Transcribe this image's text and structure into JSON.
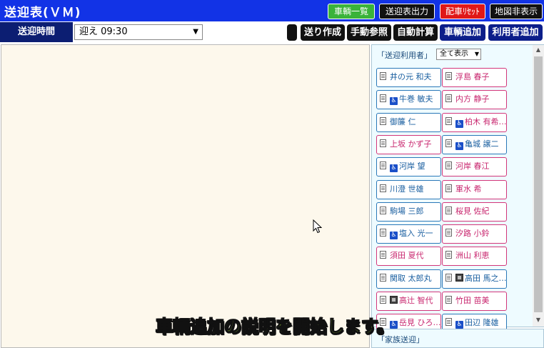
{
  "app": {
    "title": "送迎表(ＶＭ)"
  },
  "header_buttons": [
    {
      "label": "車輌一覧",
      "color": "#3ab33a"
    },
    {
      "label": "送迎表出力",
      "color": "#111111"
    },
    {
      "label": "配車ﾘｾｯﾄ",
      "color": "#e01818"
    },
    {
      "label": "地図非表示",
      "color": "#111111"
    }
  ],
  "toolbar": {
    "time_label": "送迎時間",
    "time_value": "迎え 09:30",
    "blank_button": "",
    "buttons": [
      {
        "label": "送り作成",
        "color": "#111111"
      },
      {
        "label": "手動参照",
        "color": "#111111"
      },
      {
        "label": "自動計算",
        "color": "#111111"
      },
      {
        "label": "車輌追加",
        "color": "#0c1e8a"
      },
      {
        "label": "利用者追加",
        "color": "#0c1e8a"
      }
    ]
  },
  "users_panel": {
    "title": "「送迎利用者」",
    "filter_value": "全て表示",
    "users": [
      {
        "name": "井の元 和夫",
        "gender": "male",
        "wheelchair": false,
        "photo": false
      },
      {
        "name": "浮島 春子",
        "gender": "female",
        "wheelchair": false,
        "photo": false
      },
      {
        "name": "牛巻 敏夫",
        "gender": "male",
        "wheelchair": true,
        "photo": false
      },
      {
        "name": "内方 静子",
        "gender": "female",
        "wheelchair": false,
        "photo": false
      },
      {
        "name": "御簾 仁",
        "gender": "male",
        "wheelchair": false,
        "photo": false
      },
      {
        "name": "柏木 有希…",
        "gender": "female",
        "wheelchair": true,
        "photo": false
      },
      {
        "name": "上坂 かず子",
        "gender": "female",
        "wheelchair": false,
        "photo": false
      },
      {
        "name": "亀城 譲二",
        "gender": "male",
        "wheelchair": true,
        "photo": false
      },
      {
        "name": "河岸 望",
        "gender": "male",
        "wheelchair": true,
        "photo": false
      },
      {
        "name": "河岸 春江",
        "gender": "female",
        "wheelchair": false,
        "photo": false
      },
      {
        "name": "川澄 世雄",
        "gender": "male",
        "wheelchair": false,
        "photo": false
      },
      {
        "name": "軍水 希",
        "gender": "female",
        "wheelchair": false,
        "photo": false
      },
      {
        "name": "駒場 三郎",
        "gender": "male",
        "wheelchair": false,
        "photo": false
      },
      {
        "name": "桜見 佐紀",
        "gender": "female",
        "wheelchair": false,
        "photo": false
      },
      {
        "name": "塩入 光一",
        "gender": "male",
        "wheelchair": true,
        "photo": false
      },
      {
        "name": "汐路 小鈴",
        "gender": "female",
        "wheelchair": false,
        "photo": false
      },
      {
        "name": "須田 夏代",
        "gender": "female",
        "wheelchair": false,
        "photo": false
      },
      {
        "name": "洲山 利恵",
        "gender": "female",
        "wheelchair": false,
        "photo": false
      },
      {
        "name": "関取 太郎丸",
        "gender": "male",
        "wheelchair": false,
        "photo": false
      },
      {
        "name": "高田 馬之…",
        "gender": "male",
        "wheelchair": false,
        "photo": true
      },
      {
        "name": "高辻 智代",
        "gender": "female",
        "wheelchair": false,
        "photo": true
      },
      {
        "name": "竹田 苗美",
        "gender": "female",
        "wheelchair": false,
        "photo": false
      },
      {
        "name": "岳見 ひろ…",
        "gender": "female",
        "wheelchair": true,
        "photo": false
      },
      {
        "name": "田辺 隆雄",
        "gender": "male",
        "wheelchair": true,
        "photo": false
      }
    ]
  },
  "family_panel": {
    "title": "「家族送迎」"
  },
  "caption": "車輌追加の説明を開始します。",
  "icons": {
    "doc": "document-icon",
    "wheelchair": "wheelchair-icon",
    "photo": "photo-icon",
    "cursor": "mouse-cursor-icon"
  }
}
